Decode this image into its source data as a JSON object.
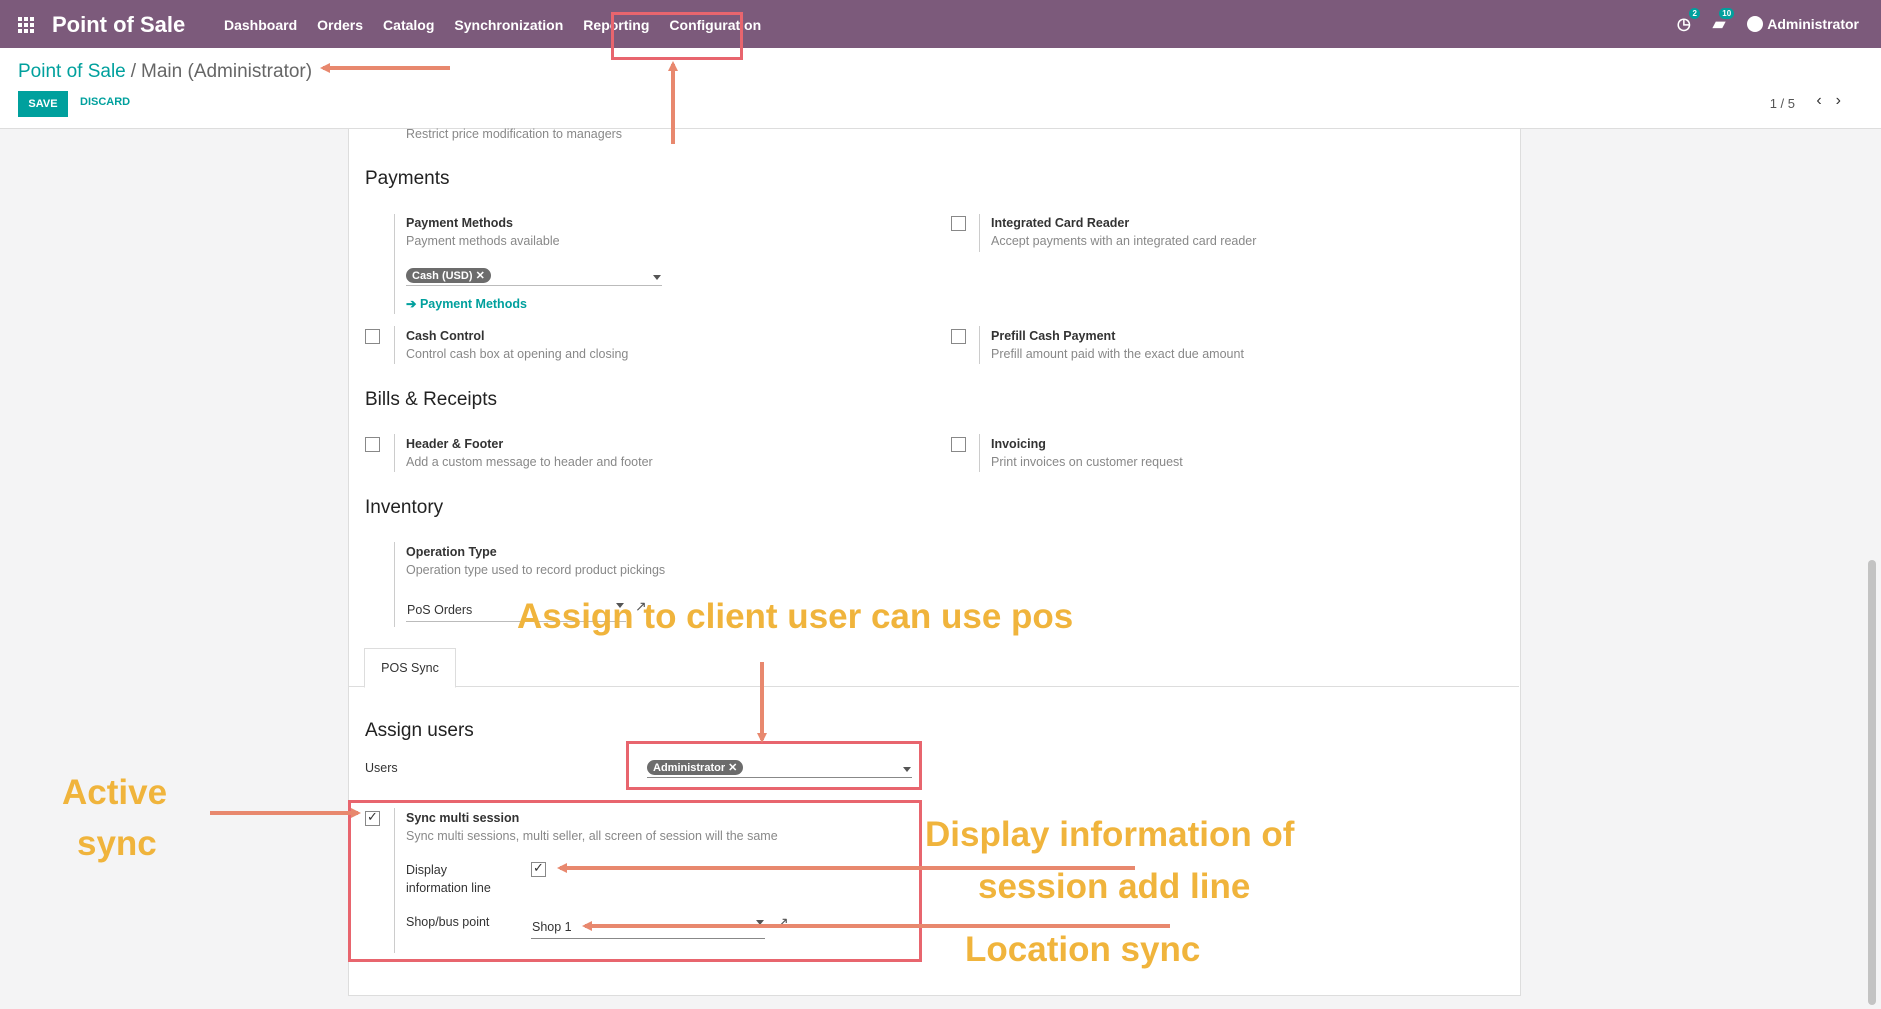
{
  "nav": {
    "brand": "Point of Sale",
    "menu": [
      "Dashboard",
      "Orders",
      "Catalog",
      "Synchronization",
      "Reporting",
      "Configuration"
    ],
    "activity_badge": "2",
    "messages_badge": "10",
    "user": "Administrator"
  },
  "breadcrumb": {
    "root": "Point of Sale",
    "separator": "/",
    "current": "Main (Administrator)"
  },
  "actions": {
    "save": "SAVE",
    "discard": "DISCARD"
  },
  "pager": "1 / 5",
  "form": {
    "restrict_help": "Restrict price modification to managers",
    "payments": {
      "title": "Payments",
      "methods_label": "Payment Methods",
      "methods_help": "Payment methods available",
      "methods_tag": "Cash (USD)",
      "methods_link": "Payment Methods",
      "card_label": "Integrated Card Reader",
      "card_help": "Accept payments with an integrated card reader",
      "cash_label": "Cash Control",
      "cash_help": "Control cash box at opening and closing",
      "prefill_label": "Prefill Cash Payment",
      "prefill_help": "Prefill amount paid with the exact due amount"
    },
    "bills": {
      "title": "Bills & Receipts",
      "header_label": "Header & Footer",
      "header_help": "Add a custom message to header and footer",
      "invoicing_label": "Invoicing",
      "invoicing_help": "Print invoices on customer request"
    },
    "inventory": {
      "title": "Inventory",
      "op_label": "Operation Type",
      "op_help": "Operation type used to record product pickings",
      "op_value": "PoS Orders"
    },
    "tab": "POS Sync",
    "assign": {
      "title": "Assign users",
      "users_label": "Users",
      "users_tag": "Administrator",
      "sync_label": "Sync multi session",
      "sync_help": "Sync multi sessions, multi seller, all screen of session will the same",
      "sync_checked": true,
      "display_label_1": "Display",
      "display_label_2": "information line",
      "display_checked": true,
      "shop_label": "Shop/bus point",
      "shop_value": "Shop 1"
    }
  },
  "annotations": {
    "assign": "Assign to client user can use pos",
    "active_1": "Active",
    "active_2": "sync",
    "display_1": "Display information of",
    "display_2": "session add line",
    "location": "Location sync"
  },
  "colors": {
    "navbar": "#7c5a7b",
    "accent": "#00a09d",
    "annotation": "#f0b43c",
    "highlight": "#e8656e"
  }
}
